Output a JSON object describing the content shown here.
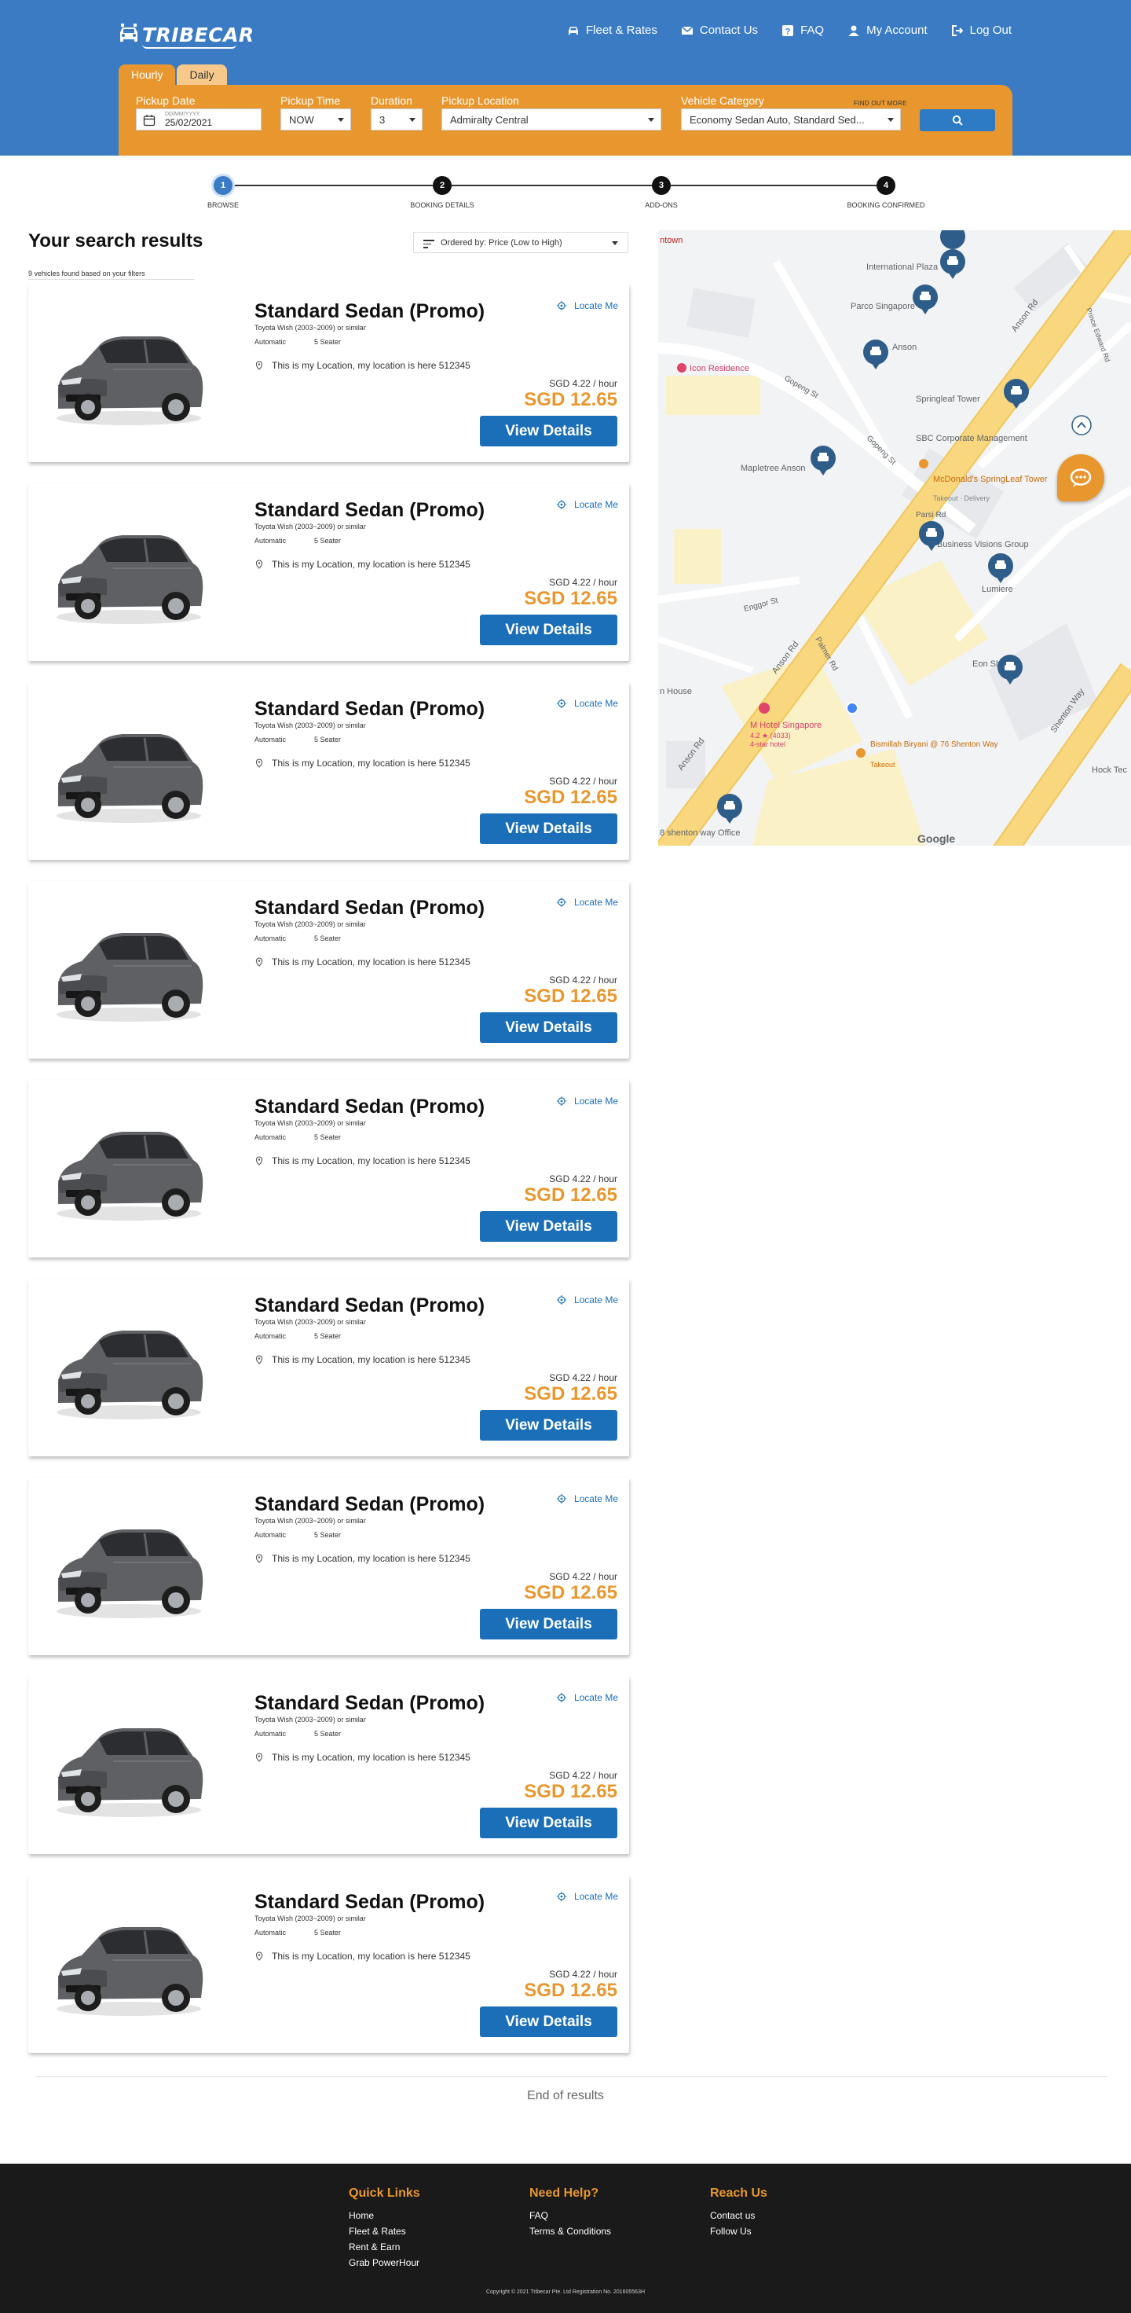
{
  "header": {
    "logo_text": "TRIBECAR",
    "nav": [
      {
        "label": "Fleet & Rates",
        "icon": "car-icon"
      },
      {
        "label": "Contact Us",
        "icon": "envelope-icon"
      },
      {
        "label": "FAQ",
        "icon": "question-icon"
      },
      {
        "label": "My Account",
        "icon": "user-icon"
      },
      {
        "label": "Log Out",
        "icon": "logout-icon"
      }
    ]
  },
  "search": {
    "tabs": [
      "Hourly",
      "Daily"
    ],
    "pickup_date_label": "Pickup Date",
    "pickup_date_format": "DD/MM/YYYY",
    "pickup_date_value": "25/02/2021",
    "pickup_time_label": "Pickup Time",
    "pickup_time_value": "NOW",
    "duration_label": "Duration",
    "duration_value": "3",
    "location_label": "Pickup Location",
    "location_value": "Admiralty Central",
    "category_label": "Vehicle Category",
    "find_out_more": "FIND OUT MORE",
    "category_value": "Economy Sedan Auto, Standard Sed..."
  },
  "steps": [
    {
      "num": "1",
      "label": "BROWSE"
    },
    {
      "num": "2",
      "label": "BOOKING DETAILS"
    },
    {
      "num": "3",
      "label": "ADD-ONS"
    },
    {
      "num": "4",
      "label": "BOOKING CONFIRMED"
    }
  ],
  "results": {
    "title": "Your search results",
    "order_label": "Ordered by: Price (Low to High)",
    "count_text": "9 vehicles found based on your filters",
    "end_text": "End of results",
    "cards": [
      {
        "title": "Standard Sedan (Promo)",
        "subtitle": "Toyota Wish (2003~2009) or similar",
        "transmission": "Automatic",
        "seats": "5 Seater",
        "location": "This is my Location, my location is here 512345",
        "locate_label": "Locate Me",
        "rate": "SGD 4.22 / hour",
        "price": "SGD 12.65",
        "button": "View Details"
      },
      {
        "title": "Standard Sedan (Promo)",
        "subtitle": "Toyota Wish (2003~2009) or similar",
        "transmission": "Automatic",
        "seats": "5 Seater",
        "location": "This is my Location, my location is here 512345",
        "locate_label": "Locate Me",
        "rate": "SGD 4.22 / hour",
        "price": "SGD 12.65",
        "button": "View Details"
      },
      {
        "title": "Standard Sedan (Promo)",
        "subtitle": "Toyota Wish (2003~2009) or similar",
        "transmission": "Automatic",
        "seats": "5 Seater",
        "location": "This is my Location, my location is here 512345",
        "locate_label": "Locate Me",
        "rate": "SGD 4.22 / hour",
        "price": "SGD 12.65",
        "button": "View Details"
      },
      {
        "title": "Standard Sedan (Promo)",
        "subtitle": "Toyota Wish (2003~2009) or similar",
        "transmission": "Automatic",
        "seats": "5 Seater",
        "location": "This is my Location, my location is here 512345",
        "locate_label": "Locate Me",
        "rate": "SGD 4.22 / hour",
        "price": "SGD 12.65",
        "button": "View Details"
      },
      {
        "title": "Standard Sedan (Promo)",
        "subtitle": "Toyota Wish (2003~2009) or similar",
        "transmission": "Automatic",
        "seats": "5 Seater",
        "location": "This is my Location, my location is here 512345",
        "locate_label": "Locate Me",
        "rate": "SGD 4.22 / hour",
        "price": "SGD 12.65",
        "button": "View Details"
      },
      {
        "title": "Standard Sedan (Promo)",
        "subtitle": "Toyota Wish (2003~2009) or similar",
        "transmission": "Automatic",
        "seats": "5 Seater",
        "location": "This is my Location, my location is here 512345",
        "locate_label": "Locate Me",
        "rate": "SGD 4.22 / hour",
        "price": "SGD 12.65",
        "button": "View Details"
      },
      {
        "title": "Standard Sedan (Promo)",
        "subtitle": "Toyota Wish (2003~2009) or similar",
        "transmission": "Automatic",
        "seats": "5 Seater",
        "location": "This is my Location, my location is here 512345",
        "locate_label": "Locate Me",
        "rate": "SGD 4.22 / hour",
        "price": "SGD 12.65",
        "button": "View Details"
      },
      {
        "title": "Standard Sedan (Promo)",
        "subtitle": "Toyota Wish (2003~2009) or similar",
        "transmission": "Automatic",
        "seats": "5 Seater",
        "location": "This is my Location, my location is here 512345",
        "locate_label": "Locate Me",
        "rate": "SGD 4.22 / hour",
        "price": "SGD 12.65",
        "button": "View Details"
      },
      {
        "title": "Standard Sedan (Promo)",
        "subtitle": "Toyota Wish (2003~2009) or similar",
        "transmission": "Automatic",
        "seats": "5 Seater",
        "location": "This is my Location, my location is here 512345",
        "locate_label": "Locate Me",
        "rate": "SGD 4.22 / hour",
        "price": "SGD 12.65",
        "button": "View Details"
      }
    ]
  },
  "map": {
    "labels": {
      "international_plaza": "International Plaza",
      "parco": "Parco Singapore",
      "anson": "Anson",
      "icon_residence": "Icon Residence",
      "springleaf": "Springleaf Tower",
      "sbc": "SBC Corporate Management",
      "mcdonalds": "McDonald's SpringLeaf Tower",
      "mcdonalds_sub": "Takeout · Delivery",
      "mapletree": "Mapletree Anson",
      "parsi": "Parsi Rd",
      "business_visions": "Business Visions Group",
      "lumiere": "Lumiere",
      "enggor": "Enggor St",
      "anson_rd_1": "Anson Rd",
      "anson_rd_2": "Anson Rd",
      "anson_rd_3": "Anson Rd",
      "gopeng_1": "Gopeng St",
      "gopeng_2": "Gopeng St",
      "palmer": "Palmer Rd",
      "shenton": "Shenton Way",
      "prince_edward": "Prince Edward Rd",
      "eon": "Eon Sh",
      "m_hotel": "M Hotel Singapore",
      "m_hotel_rating": "4.2 ★ (4033)",
      "m_hotel_type": "4-star hotel",
      "bismillah": "Bismillah Biryani @ 76 Shenton Way",
      "bismillah_sub": "Takeout",
      "hock_teck": "Hock Tec",
      "shenton_office": "8 shenton way Office",
      "town": "ntown",
      "house": "n House",
      "google": "Google"
    },
    "colors": {
      "road": "#f9d77e",
      "road_edge": "#f0c75b",
      "park": "#fbf1c7",
      "pin": "#2f5d8a",
      "building": "#e3e5e8"
    }
  },
  "footer": {
    "quick_links_title": "Quick Links",
    "quick_links": [
      "Home",
      "Fleet & Rates",
      "Rent & Earn",
      "Grab PowerHour"
    ],
    "help_title": "Need Help?",
    "help_links": [
      "FAQ",
      "Terms & Conditions"
    ],
    "reach_title": "Reach Us",
    "reach_links": [
      "Contact us",
      "Follow Us"
    ],
    "copyright": "Copyright © 2021 Tribecar Pte. Ltd Registration No. 201605563H"
  },
  "colors": {
    "brand_blue": "#3a7bc4",
    "accent_orange": "#e8972e",
    "button_blue": "#1a6fb8",
    "footer_bg": "#1a1a1a"
  }
}
